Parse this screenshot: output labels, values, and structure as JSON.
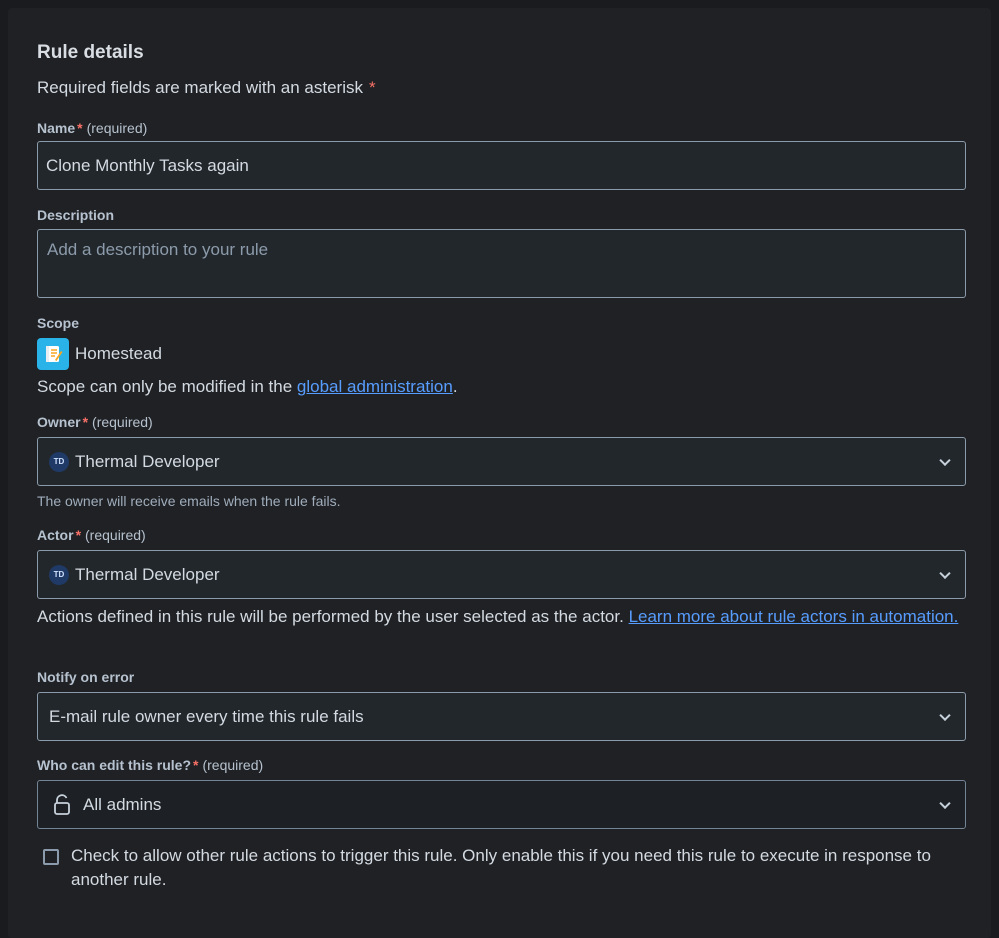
{
  "section": {
    "title": "Rule details",
    "required_note": "Required fields are marked with an asterisk",
    "asterisk": "*"
  },
  "name": {
    "label": "Name",
    "star": "*",
    "required_text": "(required)",
    "value": "Clone Monthly Tasks again"
  },
  "description": {
    "label": "Description",
    "placeholder": "Add a description to your rule"
  },
  "scope": {
    "label": "Scope",
    "icon": "notepad-icon",
    "value": "Homestead",
    "note_prefix": "Scope can only be modified in the",
    "note_link": "global administration",
    "note_suffix": "."
  },
  "owner": {
    "label": "Owner",
    "star": "*",
    "required_text": "(required)",
    "avatar_initials": "TD",
    "value": "Thermal Developer",
    "helper": "The owner will receive emails when the rule fails."
  },
  "actor": {
    "label": "Actor",
    "star": "*",
    "required_text": "(required)",
    "avatar_initials": "TD",
    "value": "Thermal Developer",
    "helper_prefix": "Actions defined in this rule will be performed by the user selected as the actor.",
    "helper_link": "Learn more about rule actors in automation."
  },
  "notify": {
    "label": "Notify on error",
    "value": "E-mail rule owner every time this rule fails"
  },
  "edit_permission": {
    "label": "Who can edit this rule?",
    "star": "*",
    "required_text": "(required)",
    "icon": "unlock-icon",
    "value": "All admins"
  },
  "trigger_checkbox": {
    "checked": false,
    "label": "Check to allow other rule actions to trigger this rule. Only enable this if you need this rule to execute in response to another rule."
  },
  "colors": {
    "background": "#202124",
    "link": "#579dff",
    "required_star": "#f87168",
    "scope_icon": "#2ab3e8"
  }
}
